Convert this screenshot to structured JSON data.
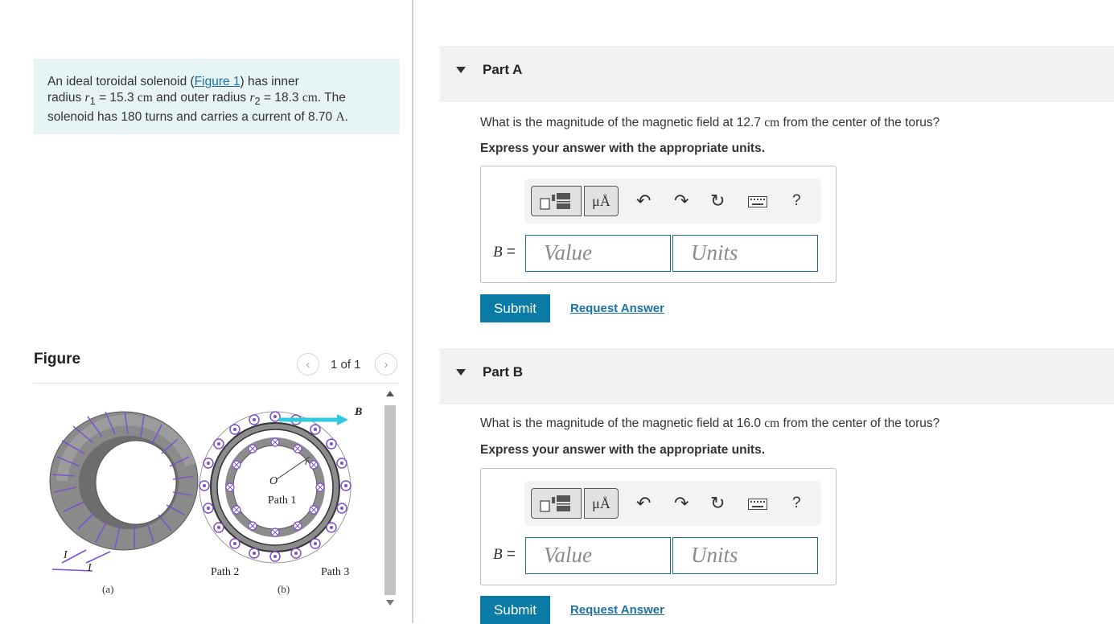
{
  "problem": {
    "intro": "An ideal toroidal solenoid (",
    "figure_link": "Figure 1",
    "after_link": ") has inner",
    "l2_a": "radius ",
    "r1_sym": "r",
    "r1_sub": "1",
    "l2_b": " = 15.3 ",
    "l2_unit1": "cm",
    "l2_c": " and outer radius ",
    "r2_sym": "r",
    "r2_sub": "2",
    "l2_d": " = 18.3 ",
    "l2_unit2": "cm",
    "l2_e": ". The",
    "l3_a": "solenoid has 180 turns and carries a current of 8.70 ",
    "l3_unit": "A",
    "l3_b": "."
  },
  "figure": {
    "title": "Figure",
    "counter": "1 of 1",
    "labels": {
      "path1": "Path 1",
      "path2": "Path 2",
      "path3": "Path 3",
      "a": "(a)",
      "b": "(b)",
      "B": "B",
      "O": "O",
      "r": "r",
      "I1": "I",
      "I2": "I"
    }
  },
  "parts": [
    {
      "title": "Part A",
      "q_a": "What is the magnitude of the magnetic field at 12.7 ",
      "q_unit": "cm",
      "q_b": " from the center of the torus?",
      "instruction": "Express your answer with the appropriate units.",
      "var": "B",
      "eq": " =",
      "value_placeholder": "Value",
      "units_placeholder": "Units",
      "units_btn": "μÅ",
      "help": "?",
      "submit": "Submit",
      "request": "Request Answer"
    },
    {
      "title": "Part B",
      "q_a": "What is the magnitude of the magnetic field at 16.0 ",
      "q_unit": "cm",
      "q_b": " from the center of the torus?",
      "instruction": "Express your answer with the appropriate units.",
      "var": "B",
      "eq": " =",
      "value_placeholder": "Value",
      "units_placeholder": "Units",
      "units_btn": "μÅ",
      "help": "?",
      "submit": "Submit",
      "request": "Request Answer"
    }
  ],
  "colors": {
    "accent": "#0a7ba6",
    "link": "#1d71a4",
    "problem_bg": "#e6f4f4",
    "current_arrow": "#7b4fd0"
  }
}
